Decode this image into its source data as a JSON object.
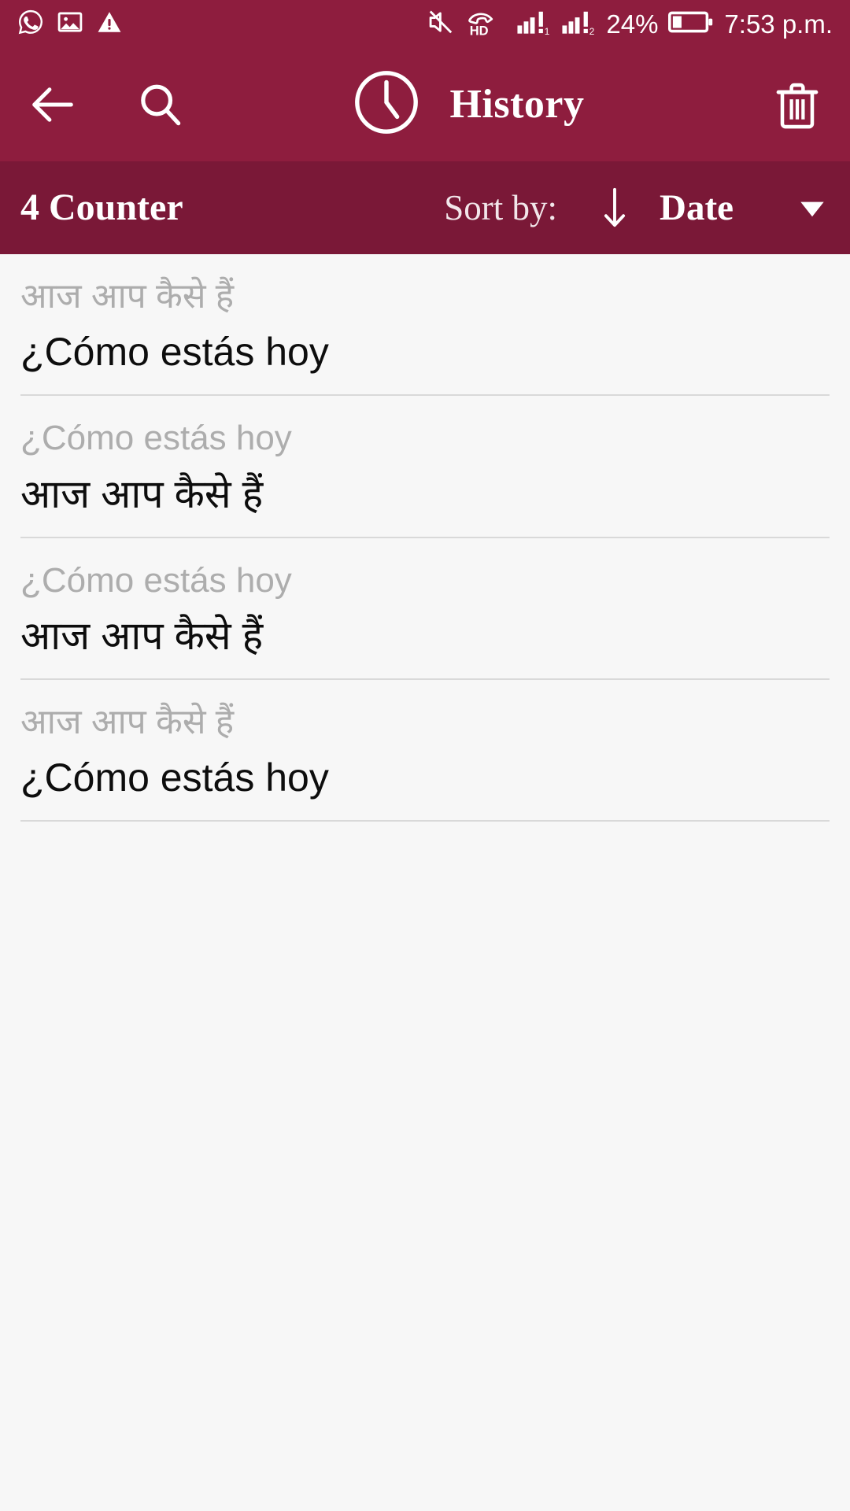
{
  "status_bar": {
    "left_icons": [
      "whatsapp-icon",
      "image-icon",
      "warning-icon"
    ],
    "right_icons": [
      "mute-icon",
      "hd-voice-icon",
      "signal-sim1-icon",
      "signal-sim2-icon",
      "battery-icon"
    ],
    "battery_percent": "24%",
    "time": "7:53 p.m.",
    "background_color": "#8e1d3e"
  },
  "app_bar": {
    "back_icon": "back-arrow-icon",
    "search_icon": "search-icon",
    "clock_icon": "clock-icon",
    "title": "History",
    "delete_icon": "trash-icon",
    "background_color": "#8e1d3e"
  },
  "sort_bar": {
    "counter": "4 Counter",
    "sort_by_label": "Sort by:",
    "sort_direction_icon": "arrow-down-icon",
    "sort_value": "Date",
    "dropdown_icon": "caret-down-icon",
    "background_color": "#7a1837"
  },
  "history": {
    "items": [
      {
        "source": "आज आप कैसे हैं",
        "target": "¿Cómo estás hoy"
      },
      {
        "source": "¿Cómo estás hoy",
        "target": "आज आप कैसे हैं"
      },
      {
        "source": "¿Cómo estás hoy",
        "target": "आज आप कैसे हैं"
      },
      {
        "source": "आज आप कैसे हैं",
        "target": "¿Cómo estás hoy"
      }
    ],
    "source_color": "#adadad",
    "target_color": "#0d0d0d"
  }
}
